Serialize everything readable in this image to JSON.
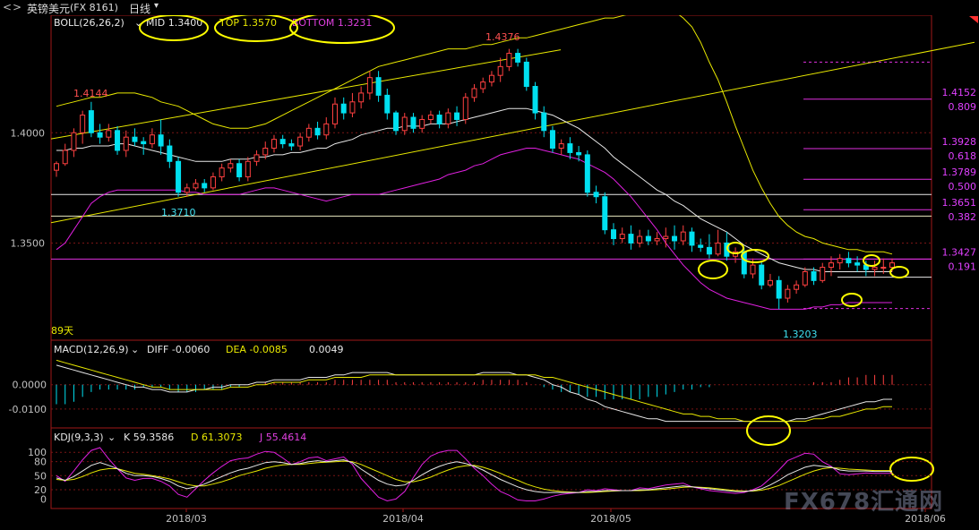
{
  "header": {
    "nav_back": "<",
    "nav_fwd": ">",
    "symbol_name": "英镑美元",
    "symbol_code": "(FX 8161)",
    "period": "日线"
  },
  "colors": {
    "up": "#ff4040",
    "down": "#00e0f0",
    "boll_mid": "#e8e8e8",
    "boll_top": "#e8e800",
    "boll_bottom": "#e020e0",
    "grid": "#8b1a1a",
    "yellow_line": "#e8e800",
    "fib": "#e030e0",
    "magenta_text": "#e040ff",
    "axis_text": "#c0c0c0",
    "ellipse": "#ffff00"
  },
  "panel_boll": {
    "label": "BOLL(26,26,2)",
    "mid": "MID 1.3400",
    "top": "TOP 1.3570",
    "bottom": "BOTTOM 1.3231",
    "high_label": "1.4376",
    "low_label": "1.3710",
    "low2_label": "1.3203",
    "left_high_label": "1.4144",
    "days_label": "89天",
    "price_ticks": [
      "1.4000",
      "1.3500"
    ],
    "fib_levels": [
      {
        "price": "1.4152",
        "ratio": "0.809"
      },
      {
        "price": "1.3928",
        "ratio": "0.618"
      },
      {
        "price": "1.3789",
        "ratio": "0.500"
      },
      {
        "price": "1.3651",
        "ratio": "0.382"
      },
      {
        "price": "1.3427",
        "ratio": "0.191"
      }
    ]
  },
  "panel_macd": {
    "label": "MACD(12,26,9)",
    "diff": "DIFF -0.0060",
    "dea": "DEA -0.0085",
    "macd": "0.0049",
    "ticks": [
      "0.0000",
      "-0.0100"
    ]
  },
  "panel_kdj": {
    "label": "KDJ(9,3,3)",
    "k": "K 59.3586",
    "d": "D 61.3073",
    "j": "J 55.4614",
    "ticks": [
      "100",
      "80",
      "50",
      "20",
      "0"
    ]
  },
  "xaxis": {
    "ticks": [
      "2018/03",
      "2018/04",
      "2018/05",
      "2018/06"
    ]
  },
  "watermark": "FX678汇通网",
  "chart_data": {
    "type": "candlestick",
    "price_scale": [
      1.31,
      1.448
    ],
    "candles": [
      [
        1.383,
        1.386,
        1.38,
        1.387
      ],
      [
        1.386,
        1.392,
        1.385,
        1.395
      ],
      [
        1.392,
        1.4,
        1.389,
        1.402
      ],
      [
        1.4,
        1.408,
        1.395,
        1.41
      ],
      [
        1.41,
        1.4,
        1.398,
        1.414
      ],
      [
        1.4,
        1.398,
        1.395,
        1.404
      ],
      [
        1.398,
        1.401,
        1.396,
        1.404
      ],
      [
        1.401,
        1.392,
        1.39,
        1.403
      ],
      [
        1.392,
        1.398,
        1.389,
        1.401
      ],
      [
        1.398,
        1.396,
        1.394,
        1.402
      ],
      [
        1.396,
        1.395,
        1.39,
        1.398
      ],
      [
        1.395,
        1.399,
        1.393,
        1.402
      ],
      [
        1.399,
        1.394,
        1.39,
        1.406
      ],
      [
        1.394,
        1.387,
        1.384,
        1.397
      ],
      [
        1.387,
        1.373,
        1.371,
        1.389
      ],
      [
        1.373,
        1.375,
        1.371,
        1.377
      ],
      [
        1.375,
        1.377,
        1.374,
        1.379
      ],
      [
        1.377,
        1.375,
        1.373,
        1.379
      ],
      [
        1.375,
        1.38,
        1.374,
        1.382
      ],
      [
        1.38,
        1.384,
        1.378,
        1.386
      ],
      [
        1.384,
        1.386,
        1.382,
        1.388
      ],
      [
        1.386,
        1.38,
        1.378,
        1.388
      ],
      [
        1.38,
        1.387,
        1.378,
        1.389
      ],
      [
        1.387,
        1.39,
        1.385,
        1.392
      ],
      [
        1.39,
        1.393,
        1.388,
        1.396
      ],
      [
        1.393,
        1.397,
        1.391,
        1.399
      ],
      [
        1.397,
        1.395,
        1.393,
        1.399
      ],
      [
        1.395,
        1.394,
        1.392,
        1.397
      ],
      [
        1.394,
        1.398,
        1.392,
        1.4
      ],
      [
        1.398,
        1.402,
        1.396,
        1.404
      ],
      [
        1.402,
        1.399,
        1.397,
        1.405
      ],
      [
        1.399,
        1.404,
        1.397,
        1.407
      ],
      [
        1.404,
        1.413,
        1.402,
        1.416
      ],
      [
        1.413,
        1.409,
        1.406,
        1.416
      ],
      [
        1.409,
        1.414,
        1.407,
        1.418
      ],
      [
        1.414,
        1.418,
        1.411,
        1.421
      ],
      [
        1.418,
        1.425,
        1.415,
        1.428
      ],
      [
        1.425,
        1.417,
        1.414,
        1.428
      ],
      [
        1.417,
        1.409,
        1.406,
        1.42
      ],
      [
        1.409,
        1.401,
        1.399,
        1.41
      ],
      [
        1.401,
        1.407,
        1.399,
        1.409
      ],
      [
        1.407,
        1.402,
        1.4,
        1.409
      ],
      [
        1.402,
        1.406,
        1.4,
        1.408
      ],
      [
        1.406,
        1.408,
        1.404,
        1.41
      ],
      [
        1.408,
        1.404,
        1.402,
        1.41
      ],
      [
        1.404,
        1.409,
        1.402,
        1.411
      ],
      [
        1.409,
        1.406,
        1.403,
        1.412
      ],
      [
        1.406,
        1.416,
        1.404,
        1.418
      ],
      [
        1.416,
        1.42,
        1.414,
        1.422
      ],
      [
        1.42,
        1.423,
        1.418,
        1.425
      ],
      [
        1.423,
        1.426,
        1.421,
        1.428
      ],
      [
        1.426,
        1.43,
        1.423,
        1.434
      ],
      [
        1.43,
        1.436,
        1.428,
        1.438
      ],
      [
        1.436,
        1.432,
        1.43,
        1.438
      ],
      [
        1.432,
        1.421,
        1.419,
        1.434
      ],
      [
        1.421,
        1.409,
        1.406,
        1.423
      ],
      [
        1.409,
        1.401,
        1.398,
        1.412
      ],
      [
        1.401,
        1.393,
        1.391,
        1.403
      ],
      [
        1.393,
        1.395,
        1.39,
        1.397
      ],
      [
        1.395,
        1.391,
        1.388,
        1.398
      ],
      [
        1.391,
        1.39,
        1.387,
        1.394
      ],
      [
        1.39,
        1.373,
        1.371,
        1.392
      ],
      [
        1.373,
        1.371,
        1.368,
        1.376
      ],
      [
        1.371,
        1.356,
        1.354,
        1.373
      ],
      [
        1.356,
        1.352,
        1.349,
        1.359
      ],
      [
        1.352,
        1.354,
        1.35,
        1.357
      ],
      [
        1.354,
        1.35,
        1.347,
        1.358
      ],
      [
        1.35,
        1.353,
        1.348,
        1.356
      ],
      [
        1.353,
        1.351,
        1.349,
        1.356
      ],
      [
        1.351,
        1.352,
        1.349,
        1.355
      ],
      [
        1.352,
        1.353,
        1.348,
        1.357
      ],
      [
        1.353,
        1.351,
        1.347,
        1.358
      ],
      [
        1.351,
        1.355,
        1.349,
        1.358
      ],
      [
        1.355,
        1.349,
        1.346,
        1.357
      ],
      [
        1.349,
        1.348,
        1.346,
        1.352
      ],
      [
        1.348,
        1.345,
        1.343,
        1.354
      ],
      [
        1.345,
        1.35,
        1.344,
        1.356
      ],
      [
        1.35,
        1.344,
        1.342,
        1.355
      ],
      [
        1.344,
        1.346,
        1.341,
        1.348
      ],
      [
        1.346,
        1.336,
        1.334,
        1.348
      ],
      [
        1.336,
        1.34,
        1.334,
        1.343
      ],
      [
        1.34,
        1.331,
        1.329,
        1.342
      ],
      [
        1.331,
        1.333,
        1.33,
        1.336
      ],
      [
        1.333,
        1.325,
        1.32,
        1.335
      ],
      [
        1.325,
        1.329,
        1.323,
        1.331
      ],
      [
        1.329,
        1.331,
        1.327,
        1.333
      ],
      [
        1.331,
        1.337,
        1.33,
        1.339
      ],
      [
        1.337,
        1.333,
        1.331,
        1.339
      ],
      [
        1.333,
        1.339,
        1.332,
        1.341
      ],
      [
        1.339,
        1.341,
        1.335,
        1.344
      ],
      [
        1.341,
        1.343,
        1.338,
        1.345
      ],
      [
        1.343,
        1.341,
        1.339,
        1.346
      ],
      [
        1.341,
        1.34,
        1.337,
        1.344
      ],
      [
        1.34,
        1.338,
        1.335,
        1.342
      ],
      [
        1.338,
        1.339,
        1.335,
        1.342
      ],
      [
        1.339,
        1.339,
        1.336,
        1.343
      ],
      [
        1.339,
        1.341,
        1.337,
        1.343
      ]
    ],
    "boll_mid": [
      1.392,
      1.392,
      1.393,
      1.393,
      1.394,
      1.394,
      1.394,
      1.395,
      1.395,
      1.394,
      1.393,
      1.392,
      1.391,
      1.39,
      1.389,
      1.388,
      1.387,
      1.387,
      1.387,
      1.387,
      1.388,
      1.388,
      1.388,
      1.389,
      1.389,
      1.39,
      1.39,
      1.391,
      1.391,
      1.392,
      1.393,
      1.393,
      1.395,
      1.396,
      1.397,
      1.399,
      1.4,
      1.401,
      1.402,
      1.402,
      1.403,
      1.403,
      1.403,
      1.404,
      1.404,
      1.404,
      1.405,
      1.406,
      1.407,
      1.408,
      1.409,
      1.41,
      1.411,
      1.411,
      1.411,
      1.41,
      1.409,
      1.408,
      1.406,
      1.404,
      1.402,
      1.399,
      1.396,
      1.393,
      1.389,
      1.386,
      1.383,
      1.38,
      1.377,
      1.374,
      1.372,
      1.369,
      1.367,
      1.364,
      1.361,
      1.359,
      1.357,
      1.355,
      1.352,
      1.349,
      1.347,
      1.345,
      1.343,
      1.341,
      1.34,
      1.339,
      1.338,
      1.338,
      1.337,
      1.337,
      1.337,
      1.337,
      1.337,
      1.337,
      1.337,
      1.337,
      1.337
    ],
    "boll_top": [
      1.412,
      1.413,
      1.414,
      1.415,
      1.416,
      1.416,
      1.417,
      1.418,
      1.418,
      1.418,
      1.417,
      1.416,
      1.414,
      1.413,
      1.412,
      1.41,
      1.408,
      1.406,
      1.404,
      1.403,
      1.402,
      1.402,
      1.402,
      1.403,
      1.404,
      1.406,
      1.408,
      1.41,
      1.412,
      1.414,
      1.416,
      1.418,
      1.42,
      1.422,
      1.424,
      1.426,
      1.428,
      1.43,
      1.431,
      1.432,
      1.433,
      1.434,
      1.435,
      1.436,
      1.437,
      1.438,
      1.438,
      1.438,
      1.439,
      1.44,
      1.44,
      1.441,
      1.442,
      1.443,
      1.443,
      1.444,
      1.445,
      1.446,
      1.447,
      1.448,
      1.449,
      1.45,
      1.451,
      1.452,
      1.452,
      1.453,
      1.454,
      1.455,
      1.456,
      1.456,
      1.456,
      1.455,
      1.452,
      1.448,
      1.441,
      1.432,
      1.424,
      1.414,
      1.403,
      1.393,
      1.383,
      1.375,
      1.368,
      1.362,
      1.358,
      1.355,
      1.353,
      1.352,
      1.35,
      1.349,
      1.348,
      1.347,
      1.347,
      1.346,
      1.346,
      1.346,
      1.345
    ],
    "boll_bottom": [
      1.347,
      1.35,
      1.356,
      1.362,
      1.368,
      1.371,
      1.373,
      1.374,
      1.374,
      1.374,
      1.374,
      1.374,
      1.374,
      1.374,
      1.374,
      1.373,
      1.373,
      1.372,
      1.372,
      1.372,
      1.372,
      1.372,
      1.373,
      1.374,
      1.375,
      1.375,
      1.374,
      1.373,
      1.372,
      1.371,
      1.37,
      1.369,
      1.37,
      1.371,
      1.372,
      1.372,
      1.372,
      1.372,
      1.373,
      1.374,
      1.375,
      1.376,
      1.377,
      1.378,
      1.379,
      1.381,
      1.382,
      1.383,
      1.385,
      1.386,
      1.388,
      1.39,
      1.391,
      1.392,
      1.393,
      1.393,
      1.392,
      1.391,
      1.39,
      1.389,
      1.388,
      1.386,
      1.384,
      1.382,
      1.379,
      1.375,
      1.371,
      1.366,
      1.361,
      1.356,
      1.35,
      1.345,
      1.34,
      1.336,
      1.332,
      1.329,
      1.327,
      1.325,
      1.324,
      1.323,
      1.322,
      1.321,
      1.32,
      1.32,
      1.32,
      1.32,
      1.32,
      1.321,
      1.321,
      1.322,
      1.322,
      1.323,
      1.323,
      1.323,
      1.323,
      1.323,
      1.323
    ],
    "macd_hist": [
      -0.008,
      -0.008,
      -0.007,
      -0.005,
      -0.003,
      -0.002,
      -0.002,
      -0.002,
      -0.002,
      -0.002,
      -0.001,
      -0.001,
      -0.001,
      -0.002,
      -0.003,
      -0.003,
      -0.003,
      -0.002,
      -0.002,
      -0.002,
      -0.001,
      -0.001,
      0.0,
      0.0,
      0.001,
      0.001,
      0.001,
      0.001,
      0.001,
      0.001,
      0.001,
      0.001,
      0.002,
      0.002,
      0.002,
      0.002,
      0.002,
      0.002,
      0.002,
      0.001,
      0.001,
      0.001,
      0.001,
      0.001,
      0.001,
      0.001,
      0.001,
      0.001,
      0.001,
      0.002,
      0.002,
      0.002,
      0.002,
      0.002,
      0.001,
      0.0,
      -0.001,
      -0.002,
      -0.003,
      -0.003,
      -0.004,
      -0.005,
      -0.005,
      -0.006,
      -0.006,
      -0.006,
      -0.006,
      -0.006,
      -0.005,
      -0.005,
      -0.004,
      -0.003,
      -0.002,
      -0.002,
      -0.001,
      -0.001,
      0.0,
      0.0,
      0.0,
      0.0,
      0.0,
      0.0,
      0.0,
      0.0,
      0.0,
      0.0,
      0.0,
      0.001,
      0.001,
      0.001,
      0.002,
      0.003,
      0.003,
      0.004,
      0.004,
      0.004,
      0.004
    ],
    "macd_diff": [
      0.008,
      0.007,
      0.006,
      0.005,
      0.004,
      0.003,
      0.002,
      0.001,
      0.0,
      -0.001,
      -0.001,
      -0.002,
      -0.002,
      -0.003,
      -0.003,
      -0.003,
      -0.002,
      -0.002,
      -0.001,
      -0.001,
      0.0,
      0.0,
      0.0,
      0.001,
      0.001,
      0.002,
      0.002,
      0.002,
      0.002,
      0.003,
      0.003,
      0.003,
      0.004,
      0.004,
      0.005,
      0.005,
      0.005,
      0.005,
      0.005,
      0.004,
      0.004,
      0.004,
      0.004,
      0.004,
      0.004,
      0.004,
      0.004,
      0.004,
      0.004,
      0.005,
      0.005,
      0.005,
      0.005,
      0.004,
      0.004,
      0.003,
      0.002,
      0.0,
      -0.001,
      -0.003,
      -0.004,
      -0.006,
      -0.007,
      -0.009,
      -0.01,
      -0.011,
      -0.012,
      -0.013,
      -0.014,
      -0.014,
      -0.015,
      -0.015,
      -0.015,
      -0.015,
      -0.015,
      -0.015,
      -0.015,
      -0.015,
      -0.015,
      -0.015,
      -0.015,
      -0.015,
      -0.015,
      -0.015,
      -0.015,
      -0.014,
      -0.014,
      -0.013,
      -0.012,
      -0.011,
      -0.01,
      -0.009,
      -0.008,
      -0.007,
      -0.007,
      -0.006,
      -0.006
    ],
    "macd_dea": [
      0.01,
      0.009,
      0.008,
      0.007,
      0.006,
      0.005,
      0.004,
      0.003,
      0.002,
      0.001,
      0.0,
      -0.001,
      -0.001,
      -0.002,
      -0.002,
      -0.002,
      -0.002,
      -0.002,
      -0.002,
      -0.002,
      -0.001,
      -0.001,
      -0.001,
      0.0,
      0.0,
      0.001,
      0.001,
      0.001,
      0.001,
      0.002,
      0.002,
      0.002,
      0.003,
      0.003,
      0.003,
      0.003,
      0.004,
      0.004,
      0.004,
      0.004,
      0.004,
      0.004,
      0.004,
      0.004,
      0.004,
      0.004,
      0.004,
      0.004,
      0.004,
      0.004,
      0.004,
      0.004,
      0.004,
      0.004,
      0.004,
      0.004,
      0.003,
      0.003,
      0.002,
      0.001,
      0.0,
      -0.001,
      -0.002,
      -0.003,
      -0.004,
      -0.005,
      -0.006,
      -0.007,
      -0.008,
      -0.009,
      -0.01,
      -0.011,
      -0.012,
      -0.012,
      -0.013,
      -0.013,
      -0.014,
      -0.014,
      -0.014,
      -0.015,
      -0.015,
      -0.015,
      -0.015,
      -0.015,
      -0.015,
      -0.015,
      -0.015,
      -0.014,
      -0.014,
      -0.013,
      -0.013,
      -0.012,
      -0.011,
      -0.01,
      -0.01,
      -0.009,
      -0.009
    ],
    "kdj_k": [
      45,
      40,
      48,
      60,
      72,
      78,
      72,
      65,
      55,
      50,
      50,
      48,
      44,
      38,
      28,
      22,
      26,
      32,
      40,
      48,
      56,
      62,
      66,
      72,
      78,
      80,
      78,
      74,
      76,
      80,
      82,
      80,
      82,
      84,
      78,
      64,
      52,
      40,
      32,
      28,
      30,
      40,
      52,
      62,
      70,
      76,
      80,
      76,
      70,
      62,
      52,
      42,
      34,
      26,
      20,
      16,
      14,
      14,
      14,
      14,
      14,
      16,
      16,
      18,
      18,
      18,
      18,
      20,
      20,
      22,
      24,
      26,
      28,
      26,
      24,
      22,
      20,
      18,
      16,
      16,
      18,
      22,
      30,
      40,
      52,
      60,
      68,
      72,
      70,
      68,
      62,
      60,
      60,
      60,
      59,
      59,
      59
    ],
    "kdj_d": [
      42,
      40,
      42,
      48,
      56,
      62,
      65,
      65,
      60,
      55,
      53,
      50,
      47,
      43,
      37,
      31,
      28,
      28,
      32,
      37,
      43,
      50,
      55,
      60,
      66,
      70,
      73,
      74,
      74,
      76,
      78,
      79,
      80,
      81,
      80,
      74,
      66,
      58,
      50,
      42,
      37,
      37,
      41,
      47,
      55,
      62,
      68,
      71,
      72,
      68,
      62,
      55,
      47,
      40,
      32,
      26,
      21,
      18,
      16,
      15,
      14,
      14,
      15,
      16,
      17,
      18,
      18,
      18,
      19,
      20,
      21,
      23,
      25,
      26,
      25,
      24,
      22,
      20,
      18,
      17,
      17,
      19,
      23,
      29,
      37,
      45,
      53,
      60,
      65,
      67,
      66,
      64,
      63,
      62,
      61,
      61,
      61
    ],
    "kdj_j": [
      50,
      38,
      60,
      84,
      104,
      110,
      86,
      65,
      45,
      40,
      44,
      44,
      38,
      28,
      10,
      4,
      22,
      40,
      56,
      70,
      82,
      86,
      88,
      96,
      102,
      100,
      88,
      74,
      80,
      88,
      90,
      82,
      86,
      90,
      74,
      44,
      24,
      4,
      -4,
      0,
      16,
      46,
      74,
      92,
      100,
      104,
      104,
      86,
      66,
      50,
      32,
      16,
      8,
      -2,
      -4,
      -4,
      0,
      6,
      10,
      12,
      14,
      20,
      18,
      22,
      20,
      18,
      18,
      24,
      22,
      26,
      30,
      32,
      34,
      26,
      22,
      18,
      16,
      14,
      12,
      14,
      20,
      28,
      44,
      62,
      82,
      90,
      98,
      96,
      80,
      70,
      54,
      52,
      54,
      56,
      55,
      55,
      55
    ]
  }
}
